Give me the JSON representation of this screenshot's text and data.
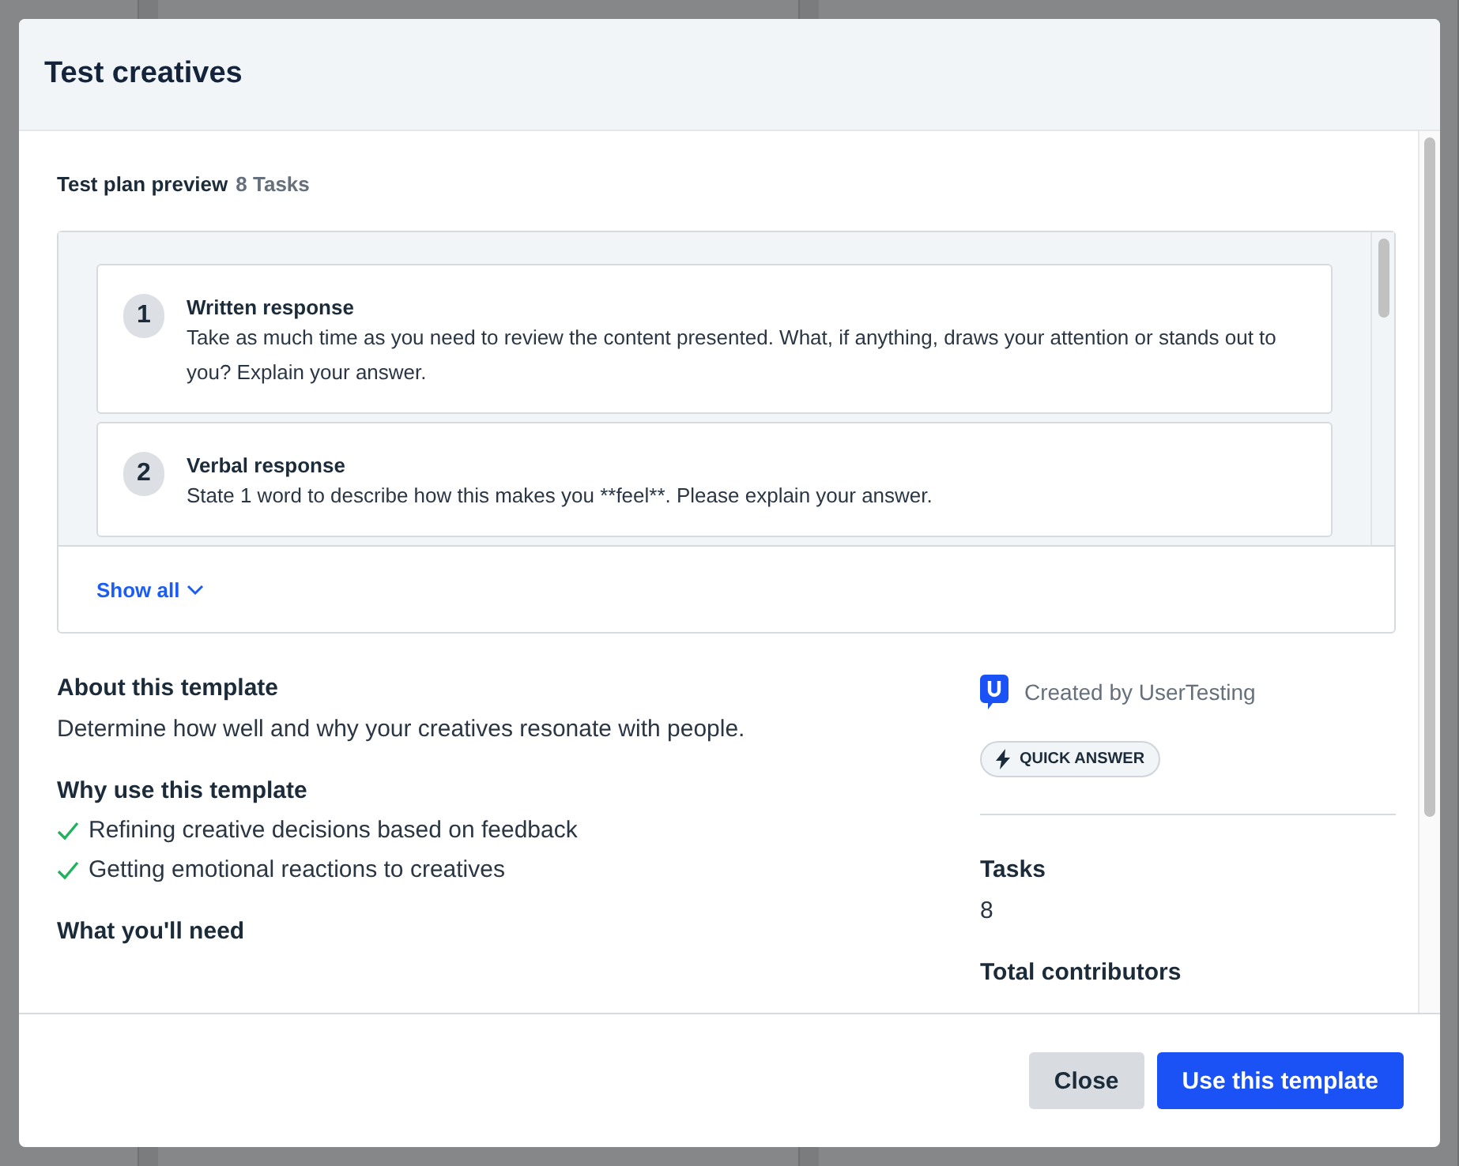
{
  "dialog": {
    "title": "Test creatives"
  },
  "preview": {
    "label": "Test plan preview",
    "count": "8 Tasks",
    "show_all": "Show all",
    "tasks": [
      {
        "number": "1",
        "title": "Written response",
        "description": "Take as much time as you need to review the content presented. What, if anything, draws your attention or stands out to you? Explain your answer."
      },
      {
        "number": "2",
        "title": "Verbal response",
        "description": "State 1 word to describe how this makes you **feel**. Please explain your answer."
      }
    ]
  },
  "about": {
    "heading": "About this template",
    "text": "Determine how well and why your creatives resonate with people."
  },
  "why": {
    "heading": "Why use this template",
    "items": [
      "Refining creative decisions based on feedback",
      "Getting emotional reactions to creatives"
    ]
  },
  "need": {
    "heading": "What you'll need"
  },
  "creator": {
    "text": "Created by UserTesting"
  },
  "badge": {
    "label": "QUICK ANSWER"
  },
  "stats": [
    {
      "label": "Tasks",
      "value": "8"
    },
    {
      "label": "Total contributors"
    }
  ],
  "buttons": [
    {
      "label": "Close",
      "kind": "secondary"
    },
    {
      "label": "Use this template",
      "kind": "primary"
    }
  ]
}
